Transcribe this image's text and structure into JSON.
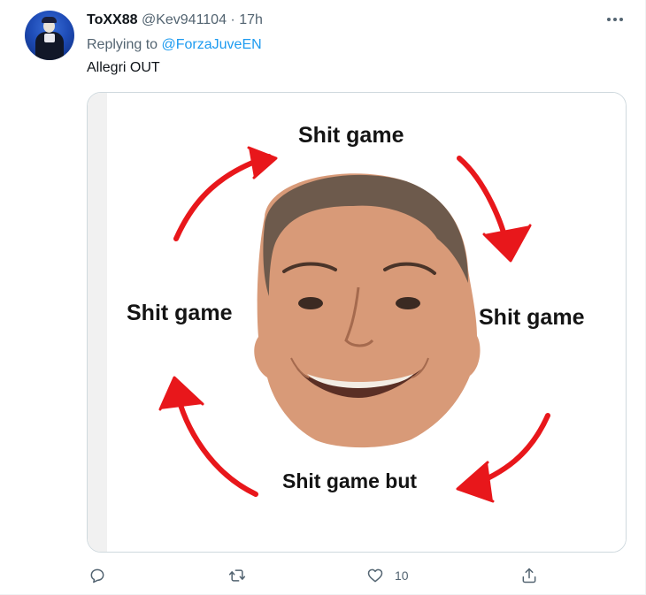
{
  "tweet": {
    "display_name": "ToXX88",
    "handle": "@Kev941104",
    "separator": "·",
    "time": "17h",
    "replying_prefix": "Replying to",
    "replying_to": "@ForzaJuveEN",
    "text": "Allegri OUT",
    "more_icon": "more-icon"
  },
  "media": {
    "labels": {
      "top": "Shit game",
      "left": "Shit game",
      "right": "Shit game",
      "bottom": "Shit game but"
    },
    "arrow_color": "#e8171b"
  },
  "actions": {
    "reply": {
      "icon": "reply-icon",
      "count": ""
    },
    "retweet": {
      "icon": "retweet-icon",
      "count": ""
    },
    "like": {
      "icon": "heart-icon",
      "count": "10"
    },
    "share": {
      "icon": "share-icon",
      "count": ""
    }
  },
  "colors": {
    "link": "#1d9bf0",
    "secondary": "#536471",
    "text": "#0f1419"
  }
}
